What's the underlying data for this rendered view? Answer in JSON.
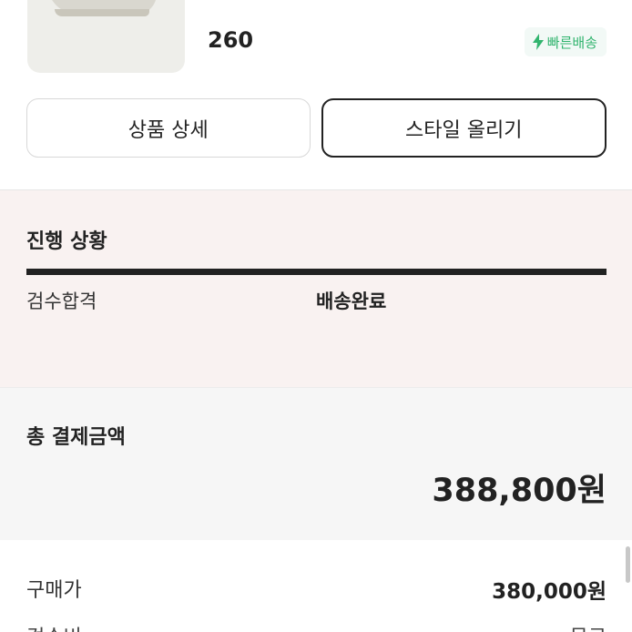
{
  "product": {
    "size": "260",
    "badge_label": "빠른배송",
    "badge_color": "#31b46e"
  },
  "actions": {
    "detail_label": "상품 상세",
    "style_label": "스타일 올리기"
  },
  "progress": {
    "title": "진행 상황",
    "steps": [
      "검수합격",
      "배송완료"
    ]
  },
  "payment": {
    "title": "총 결제금액",
    "total": "388,800원"
  },
  "breakdown": [
    {
      "label": "구매가",
      "value": "380,000원"
    },
    {
      "label": "검수비",
      "value": "무료"
    }
  ]
}
